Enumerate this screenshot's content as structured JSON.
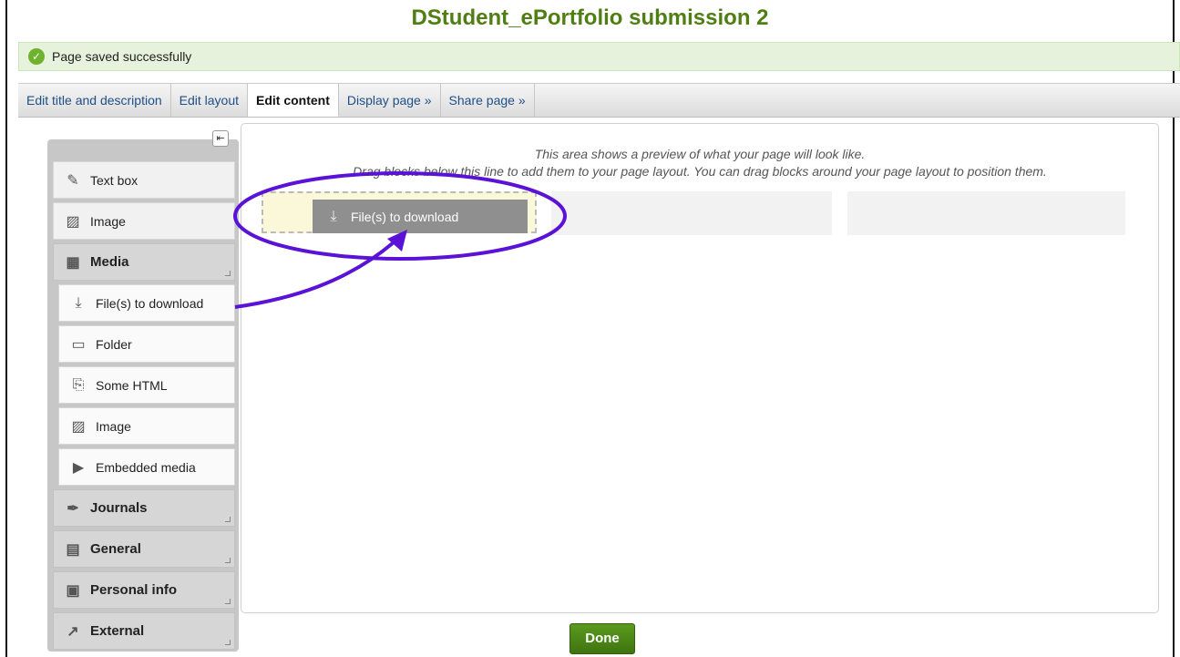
{
  "page": {
    "title": "DStudent_ePortfolio submission 2"
  },
  "status": {
    "message": "Page saved successfully"
  },
  "tabs": [
    {
      "label": "Edit title and description"
    },
    {
      "label": "Edit layout"
    },
    {
      "label": "Edit content",
      "active": true
    },
    {
      "label": "Display page »"
    },
    {
      "label": "Share page »"
    }
  ],
  "sidebar": {
    "text_box": "Text box",
    "image": "Image",
    "media": "Media",
    "files_to_download": "File(s) to download",
    "folder": "Folder",
    "some_html": "Some HTML",
    "media_image": "Image",
    "embedded_media": "Embedded media",
    "journals": "Journals",
    "general": "General",
    "personal_info": "Personal info",
    "external": "External"
  },
  "preview": {
    "line1": "This area shows a preview of what your page will look like.",
    "line2": "Drag blocks below this line to add them to your page layout. You can drag blocks around your page layout to position them.",
    "dragged_block": "File(s) to download"
  },
  "actions": {
    "done": "Done"
  },
  "colors": {
    "title": "#4f7f12",
    "tab_link": "#1e4f86",
    "annotation": "#5a12d6",
    "done_button": "#4a8516"
  }
}
